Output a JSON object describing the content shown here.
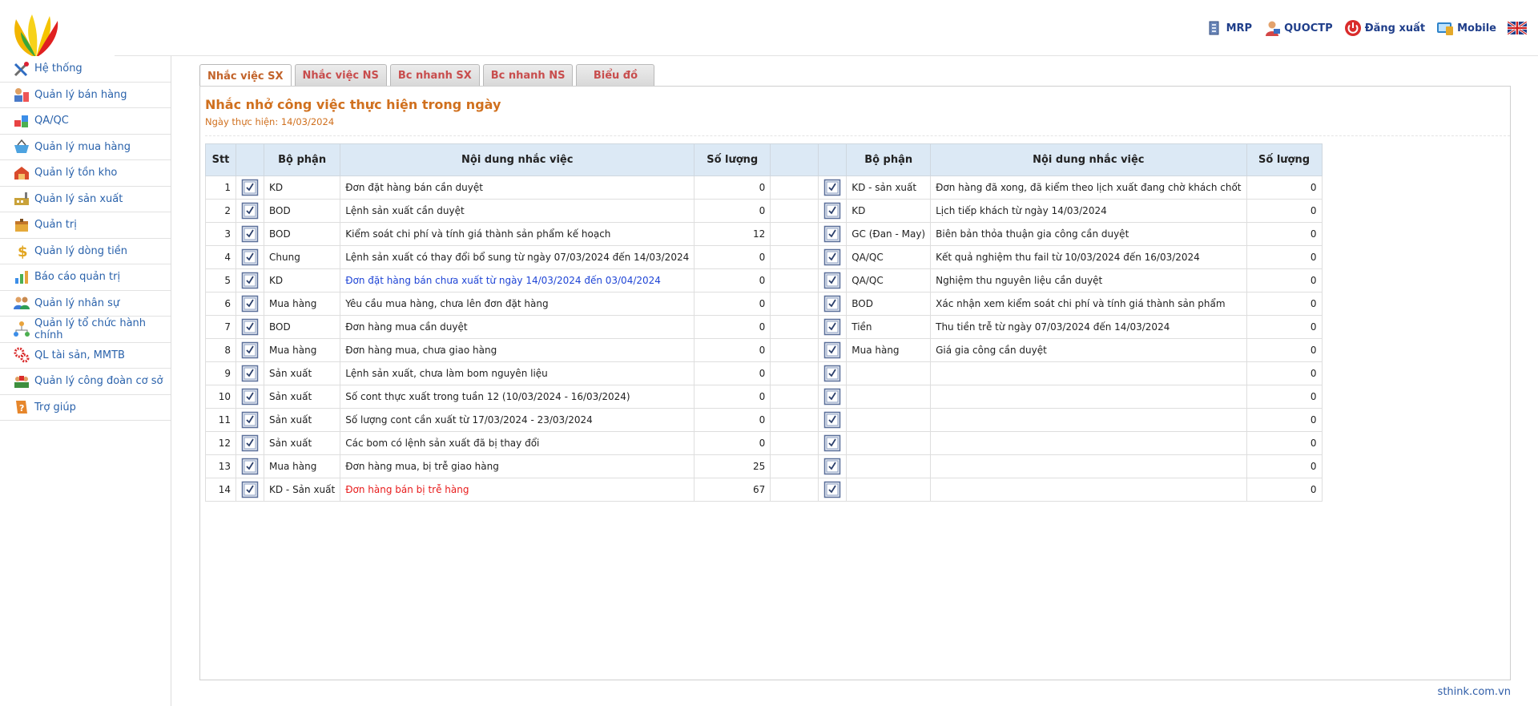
{
  "topnav": [
    {
      "label": "MRP",
      "icon": "mrp-icon"
    },
    {
      "label": "QUOCTP",
      "icon": "user-icon"
    },
    {
      "label": "Đăng xuất",
      "icon": "power-icon"
    },
    {
      "label": "Mobile",
      "icon": "mobile-icon"
    },
    {
      "label": "",
      "icon": "uk-flag-icon"
    }
  ],
  "sidebar": {
    "items": [
      {
        "label": "Hệ thống",
        "icon": "tools-icon"
      },
      {
        "label": "Quản lý bán hàng",
        "icon": "sales-icon"
      },
      {
        "label": "QA/QC",
        "icon": "qaqc-icon"
      },
      {
        "label": "Quản lý mua hàng",
        "icon": "basket-icon"
      },
      {
        "label": "Quản lý tồn kho",
        "icon": "warehouse-icon"
      },
      {
        "label": "Quản lý sản xuất",
        "icon": "factory-icon"
      },
      {
        "label": "Quản trị",
        "icon": "admin-icon"
      },
      {
        "label": "Quản lý dòng tiền",
        "icon": "dollar-icon"
      },
      {
        "label": "Báo cáo quản trị",
        "icon": "report-icon"
      },
      {
        "label": "Quản lý nhân sự",
        "icon": "people-icon"
      },
      {
        "label": "Quản lý tổ chức hành chính",
        "icon": "org-icon"
      },
      {
        "label": "QL tài sản, MMTB",
        "icon": "gears-icon"
      },
      {
        "label": "Quản lý công đoàn cơ sở",
        "icon": "union-icon"
      },
      {
        "label": "Trợ giúp",
        "icon": "help-icon"
      }
    ]
  },
  "tabs": [
    {
      "label": "Nhắc việc SX",
      "active": true
    },
    {
      "label": "Nhắc việc NS"
    },
    {
      "label": "Bc nhanh SX"
    },
    {
      "label": "Bc nhanh NS"
    },
    {
      "label": "Biểu đồ"
    }
  ],
  "panel": {
    "title": "Nhắc nhở công việc thực hiện trong ngày",
    "date_line": "Ngày thực hiện: 14/03/2024"
  },
  "table": {
    "headers": {
      "stt": "Stt",
      "dept": "Bộ phận",
      "content": "Nội dung nhắc việc",
      "qty": "Số lượng",
      "dept2": "Bộ phận",
      "content2": "Nội dung nhắc việc",
      "qty2": "Số lượng"
    },
    "rows": [
      {
        "stt": "1",
        "dept": "KD",
        "content": "Đơn đặt hàng bán cần duyệt",
        "qty": "0",
        "dept2": "KD - sản xuất",
        "content2": "Đơn hàng đã xong, đã kiểm theo lịch xuất đang chờ khách chốt",
        "qty2": "0"
      },
      {
        "stt": "2",
        "dept": "BOD",
        "content": "Lệnh sản xuất cần duyệt",
        "qty": "0",
        "dept2": "KD",
        "content2": "Lịch tiếp khách từ ngày 14/03/2024",
        "qty2": "0"
      },
      {
        "stt": "3",
        "dept": "BOD",
        "content": "Kiểm soát chi phí và tính giá thành sản phẩm kế hoạch",
        "qty": "12",
        "dept2": "GC (Đan - May)",
        "content2": "Biên bản thỏa thuận gia công cần duyệt",
        "qty2": "0"
      },
      {
        "stt": "4",
        "dept": "Chung",
        "content": "Lệnh sản xuất có thay đổi bổ sung từ ngày 07/03/2024 đến 14/03/2024",
        "qty": "0",
        "dept2": "QA/QC",
        "content2": "Kết quả nghiệm thu fail từ 10/03/2024 đến 16/03/2024",
        "qty2": "0"
      },
      {
        "stt": "5",
        "dept": "KD",
        "content": "Đơn đặt hàng bán chưa xuất từ ngày 14/03/2024 đến 03/04/2024",
        "qty": "0",
        "style": "blue",
        "dept2": "QA/QC",
        "content2": "Nghiệm thu nguyên liệu cần duyệt",
        "qty2": "0"
      },
      {
        "stt": "6",
        "dept": "Mua hàng",
        "content": "Yêu cầu mua hàng, chưa lên đơn đặt hàng",
        "qty": "0",
        "dept2": "BOD",
        "content2": "Xác nhận xem kiểm soát chi phí và tính giá thành sản phẩm",
        "qty2": "0"
      },
      {
        "stt": "7",
        "dept": "BOD",
        "content": "Đơn hàng mua cần duyệt",
        "qty": "0",
        "dept2": "Tiền",
        "content2": "Thu tiền trễ từ ngày 07/03/2024 đến 14/03/2024",
        "qty2": "0"
      },
      {
        "stt": "8",
        "dept": "Mua hàng",
        "content": "Đơn hàng mua, chưa giao hàng",
        "qty": "0",
        "dept2": "Mua hàng",
        "content2": "Giá gia công cần duyệt",
        "qty2": "0"
      },
      {
        "stt": "9",
        "dept": "Sản xuất",
        "content": "Lệnh sản xuất, chưa làm bom nguyên liệu",
        "qty": "0",
        "dept2": "",
        "content2": "",
        "qty2": "0"
      },
      {
        "stt": "10",
        "dept": "Sản xuất",
        "content": "Số cont thực xuất trong tuần 12 (10/03/2024 - 16/03/2024)",
        "qty": "0",
        "dept2": "",
        "content2": "",
        "qty2": "0"
      },
      {
        "stt": "11",
        "dept": "Sản xuất",
        "content": "Số lượng cont cần xuất từ 17/03/2024 - 23/03/2024",
        "qty": "0",
        "dept2": "",
        "content2": "",
        "qty2": "0"
      },
      {
        "stt": "12",
        "dept": "Sản xuất",
        "content": "Các bom có lệnh sản xuất đã bị thay đổi",
        "qty": "0",
        "dept2": "",
        "content2": "",
        "qty2": "0"
      },
      {
        "stt": "13",
        "dept": "Mua hàng",
        "content": "Đơn hàng mua, bị trễ giao hàng",
        "qty": "25",
        "dept2": "",
        "content2": "",
        "qty2": "0"
      },
      {
        "stt": "14",
        "dept": "KD - Sản xuất",
        "content": "Đơn hàng bán bị trễ hàng",
        "qty": "67",
        "style": "red",
        "dept2": "",
        "content2": "",
        "qty2": "0"
      }
    ]
  },
  "footer": {
    "text": "sthink.com.vn"
  },
  "colors": {
    "accent_orange": "#d0701e",
    "tab_text": "#c84d4d",
    "sidebar_text": "#2a62ab",
    "header_bg": "#dce9f5",
    "link_blue": "#1f45d6",
    "alert_red": "#e81c1c"
  }
}
